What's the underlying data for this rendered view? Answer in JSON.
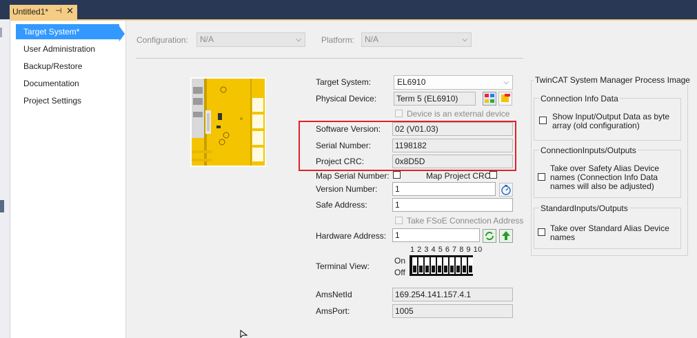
{
  "document_tab": {
    "title": "Untitled1*",
    "pin_icon": "pin-icon",
    "close_icon": "close-icon"
  },
  "nav": {
    "items": [
      {
        "label": "Target System*",
        "selected": true
      },
      {
        "label": "User Administration",
        "selected": false
      },
      {
        "label": "Backup/Restore",
        "selected": false
      },
      {
        "label": "Documentation",
        "selected": false
      },
      {
        "label": "Project Settings",
        "selected": false
      }
    ]
  },
  "toolbar": {
    "configuration_label": "Configuration:",
    "configuration_value": "N/A",
    "platform_label": "Platform:",
    "platform_value": "N/A"
  },
  "form": {
    "target_system_label": "Target System:",
    "target_system_value": "EL6910",
    "physical_device_label": "Physical Device:",
    "physical_device_value": "Term 5 (EL6910)",
    "external_device_label": "Device is an external device",
    "software_version_label": "Software Version:",
    "software_version_value": "02 (V01.03)",
    "serial_number_label": "Serial Number:",
    "serial_number_value": "1198182",
    "project_crc_label": "Project CRC:",
    "project_crc_value": "0x8D5D",
    "map_serial_label": "Map Serial Number:",
    "map_crc_label": "Map Project CRC:",
    "version_number_label": "Version Number:",
    "version_number_value": "1",
    "safe_address_label": "Safe Address:",
    "safe_address_value": "1",
    "take_fsoe_label": "Take FSoE Connection Address",
    "hardware_address_label": "Hardware Address:",
    "hardware_address_value": "1",
    "dip_numbers": "1 2 3 4 5 6 7 8 9 10",
    "terminal_view_label": "Terminal View:",
    "on_label": "On",
    "off_label": "Off",
    "dip_switches": [
      "off",
      "off",
      "off",
      "off",
      "off",
      "off",
      "off",
      "off",
      "off",
      "off"
    ],
    "amsnetid_label": "AmsNetId",
    "amsnetid_value": "169.254.141.157.4.1",
    "amsport_label": "AmsPort:",
    "amsport_value": "1005"
  },
  "process_image": {
    "title": "TwinCAT System Manager Process Image",
    "connection_info": {
      "title": "Connection Info Data",
      "checkbox_label": "Show Input/Output Data as byte array (old configuration)"
    },
    "connection_io": {
      "title": "ConnectionInputs/Outputs",
      "checkbox_label": "Take over Safety Alias Device names (Connection Info Data names will also be adjusted)"
    },
    "standard_io": {
      "title": "StandardInputs/Outputs",
      "checkbox_label": "Take over Standard Alias Device names"
    }
  },
  "colors": {
    "accent": "#3399ff",
    "tab": "#f5cc84",
    "highlight": "#e0202a",
    "terminal": "#f5c400"
  }
}
